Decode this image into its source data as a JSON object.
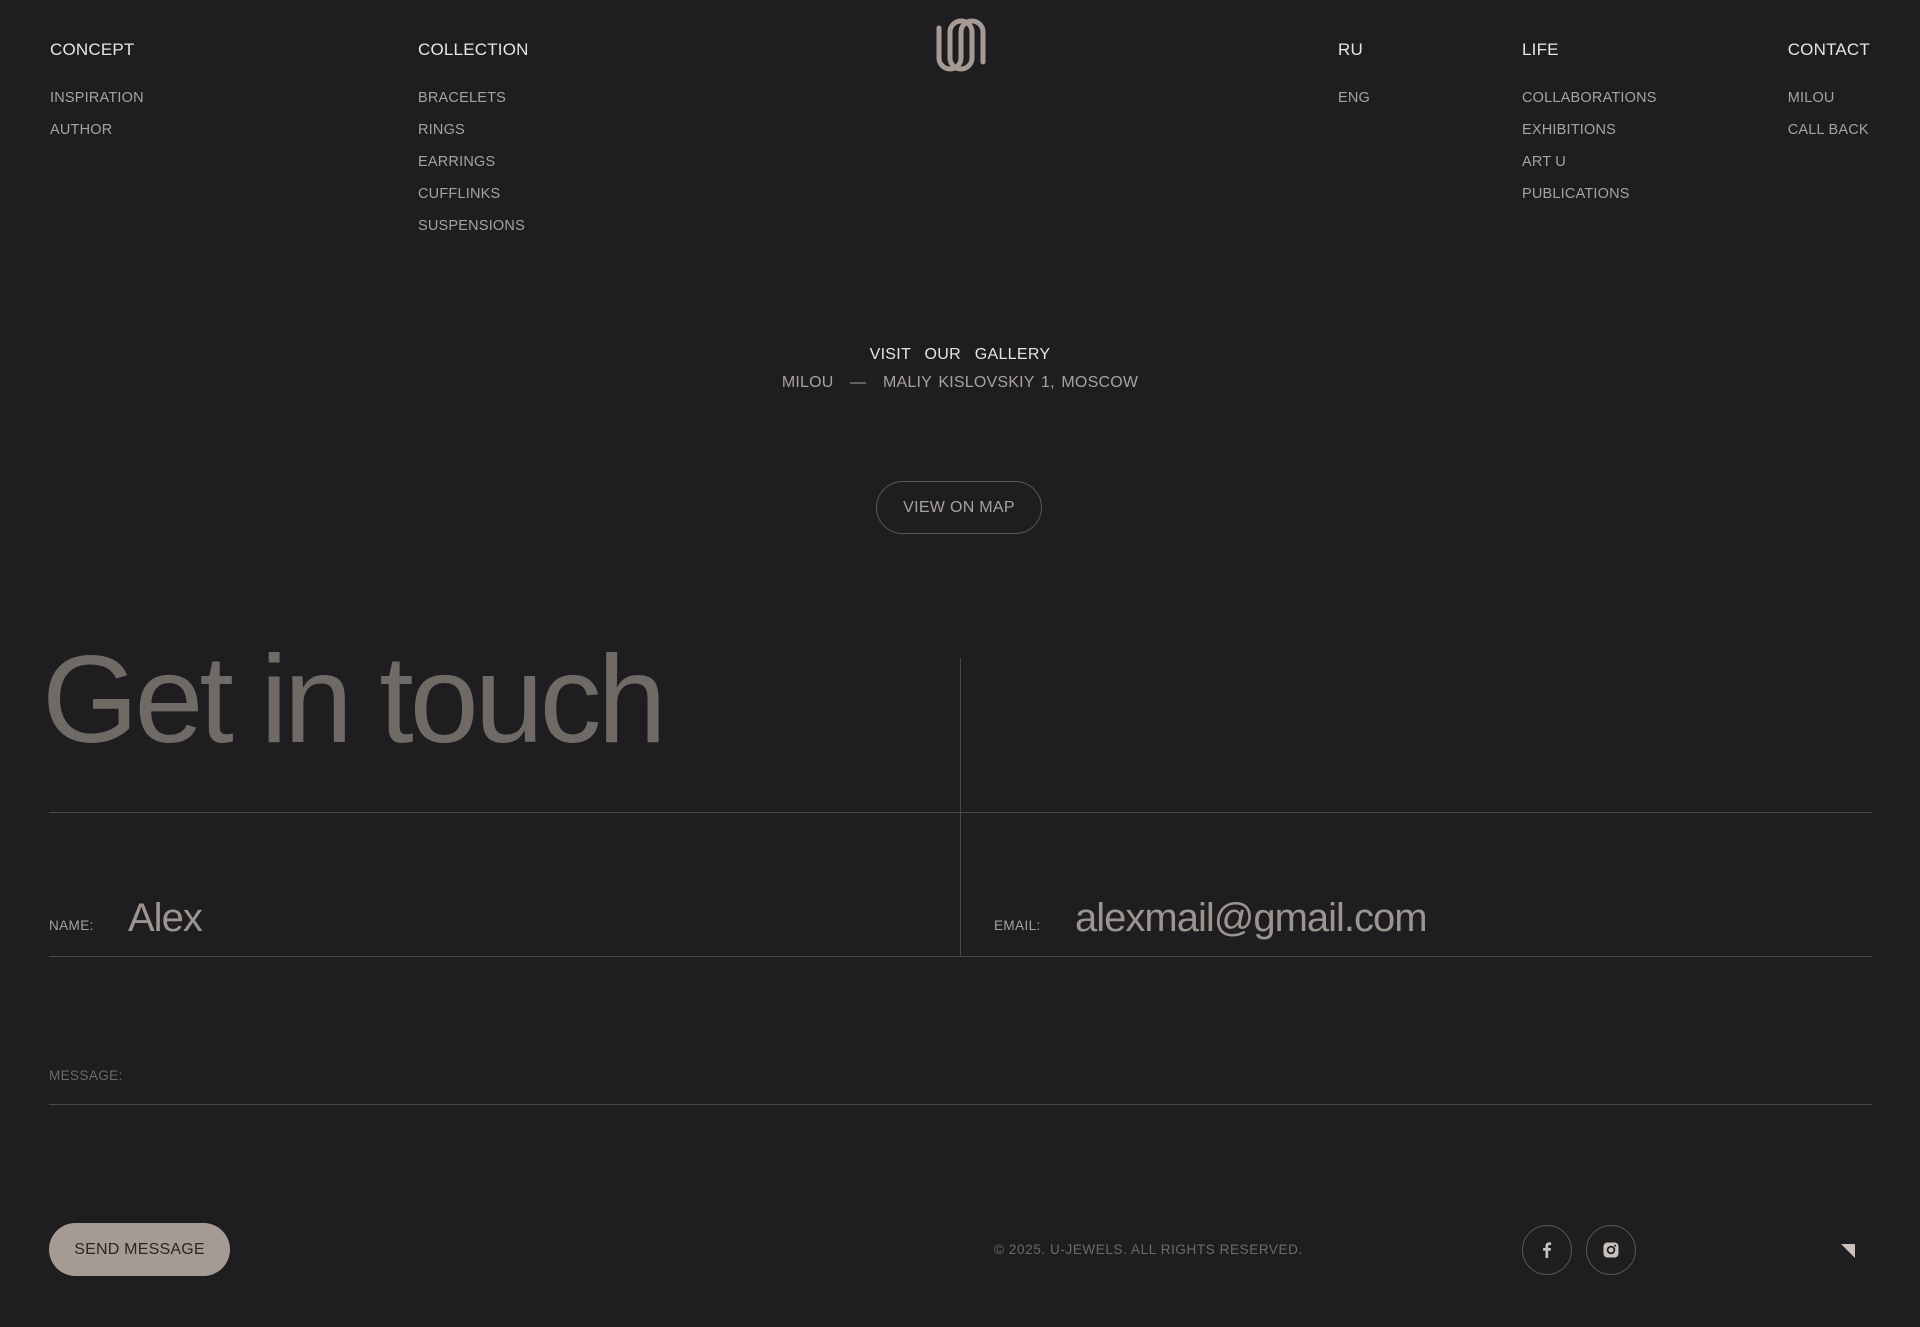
{
  "nav": {
    "concept": {
      "label": "CONCEPT",
      "items": [
        "INSPIRATION",
        "AUTHOR"
      ]
    },
    "collection": {
      "label": "COLLECTION",
      "items": [
        "BRACELETS",
        "RINGS",
        "EARRINGS",
        "CUFFLINKS",
        "SUSPENSIONS"
      ]
    },
    "language": {
      "label": "RU",
      "items": [
        "ENG"
      ]
    },
    "life": {
      "label": "LIFE",
      "items": [
        "COLLABORATIONS",
        "EXHIBITIONS",
        "ART U",
        "PUBLICATIONS"
      ]
    },
    "contact": {
      "label": "CONTACT",
      "items": [
        "MILOU",
        "CALL BACK"
      ]
    }
  },
  "logo": {
    "icon": "u-logo-icon",
    "color": "#a69b94"
  },
  "gallery": {
    "title": "VISIT OUR GALLERY",
    "address_name": "MILOU",
    "address_separator": "—",
    "address": "MALIY KISLOVSKIY 1, MOSCOW",
    "map_button": "VIEW ON MAP"
  },
  "contact_form": {
    "title": "Get in touch",
    "name_label": "NAME:",
    "name_value": "Alex",
    "email_label": "EMAIL:",
    "email_value": "alexmail@gmail.com",
    "message_label": "MESSAGE:",
    "message_value": "",
    "send_button": "SEND MESSAGE"
  },
  "footer": {
    "copyright": "© 2025. U-JEWELS. ALL RIGHTS RESERVED.",
    "social": [
      "facebook-icon",
      "instagram-icon"
    ]
  },
  "colors": {
    "background": "#1e1e20",
    "accent": "#a69b94",
    "text_primary": "#eae4de",
    "text_secondary": "#a8a29c",
    "text_muted": "#6f6a66",
    "divider": "#4a4744"
  }
}
